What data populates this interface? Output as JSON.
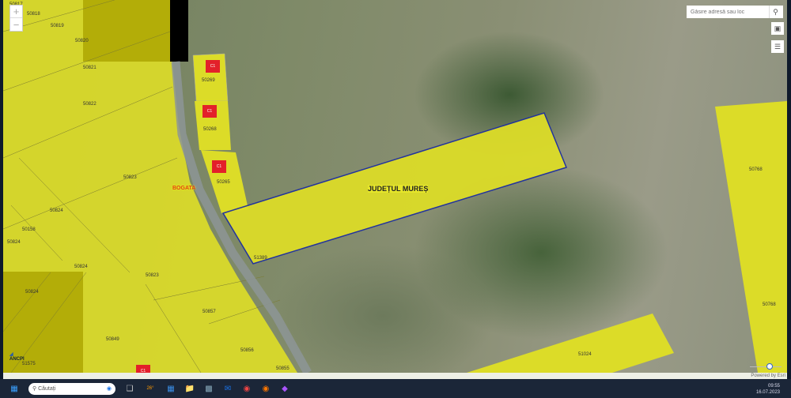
{
  "map": {
    "county_label": "JUDEȚUL MUREȘ",
    "locality_label": "BOGATA",
    "building_label": "C1",
    "parcels": [
      "50818",
      "50819",
      "50820",
      "50821",
      "50822",
      "50823",
      "50824",
      "50158",
      "50824",
      "50824",
      "50823",
      "50824",
      "50857",
      "50849",
      "50856",
      "50855",
      "50269",
      "50268",
      "50265",
      "51389",
      "51024",
      "50768",
      "50817",
      "51575"
    ],
    "search_placeholder": "Găsire adresă sau loc",
    "attribution": "Powered by Esri",
    "logo_text": "ANCPI",
    "zoom_in": "+",
    "zoom_out": "−"
  },
  "taskbar": {
    "search_placeholder": "Căutați",
    "weather": "26°",
    "time": "09:55",
    "date": "16.07.2023"
  }
}
